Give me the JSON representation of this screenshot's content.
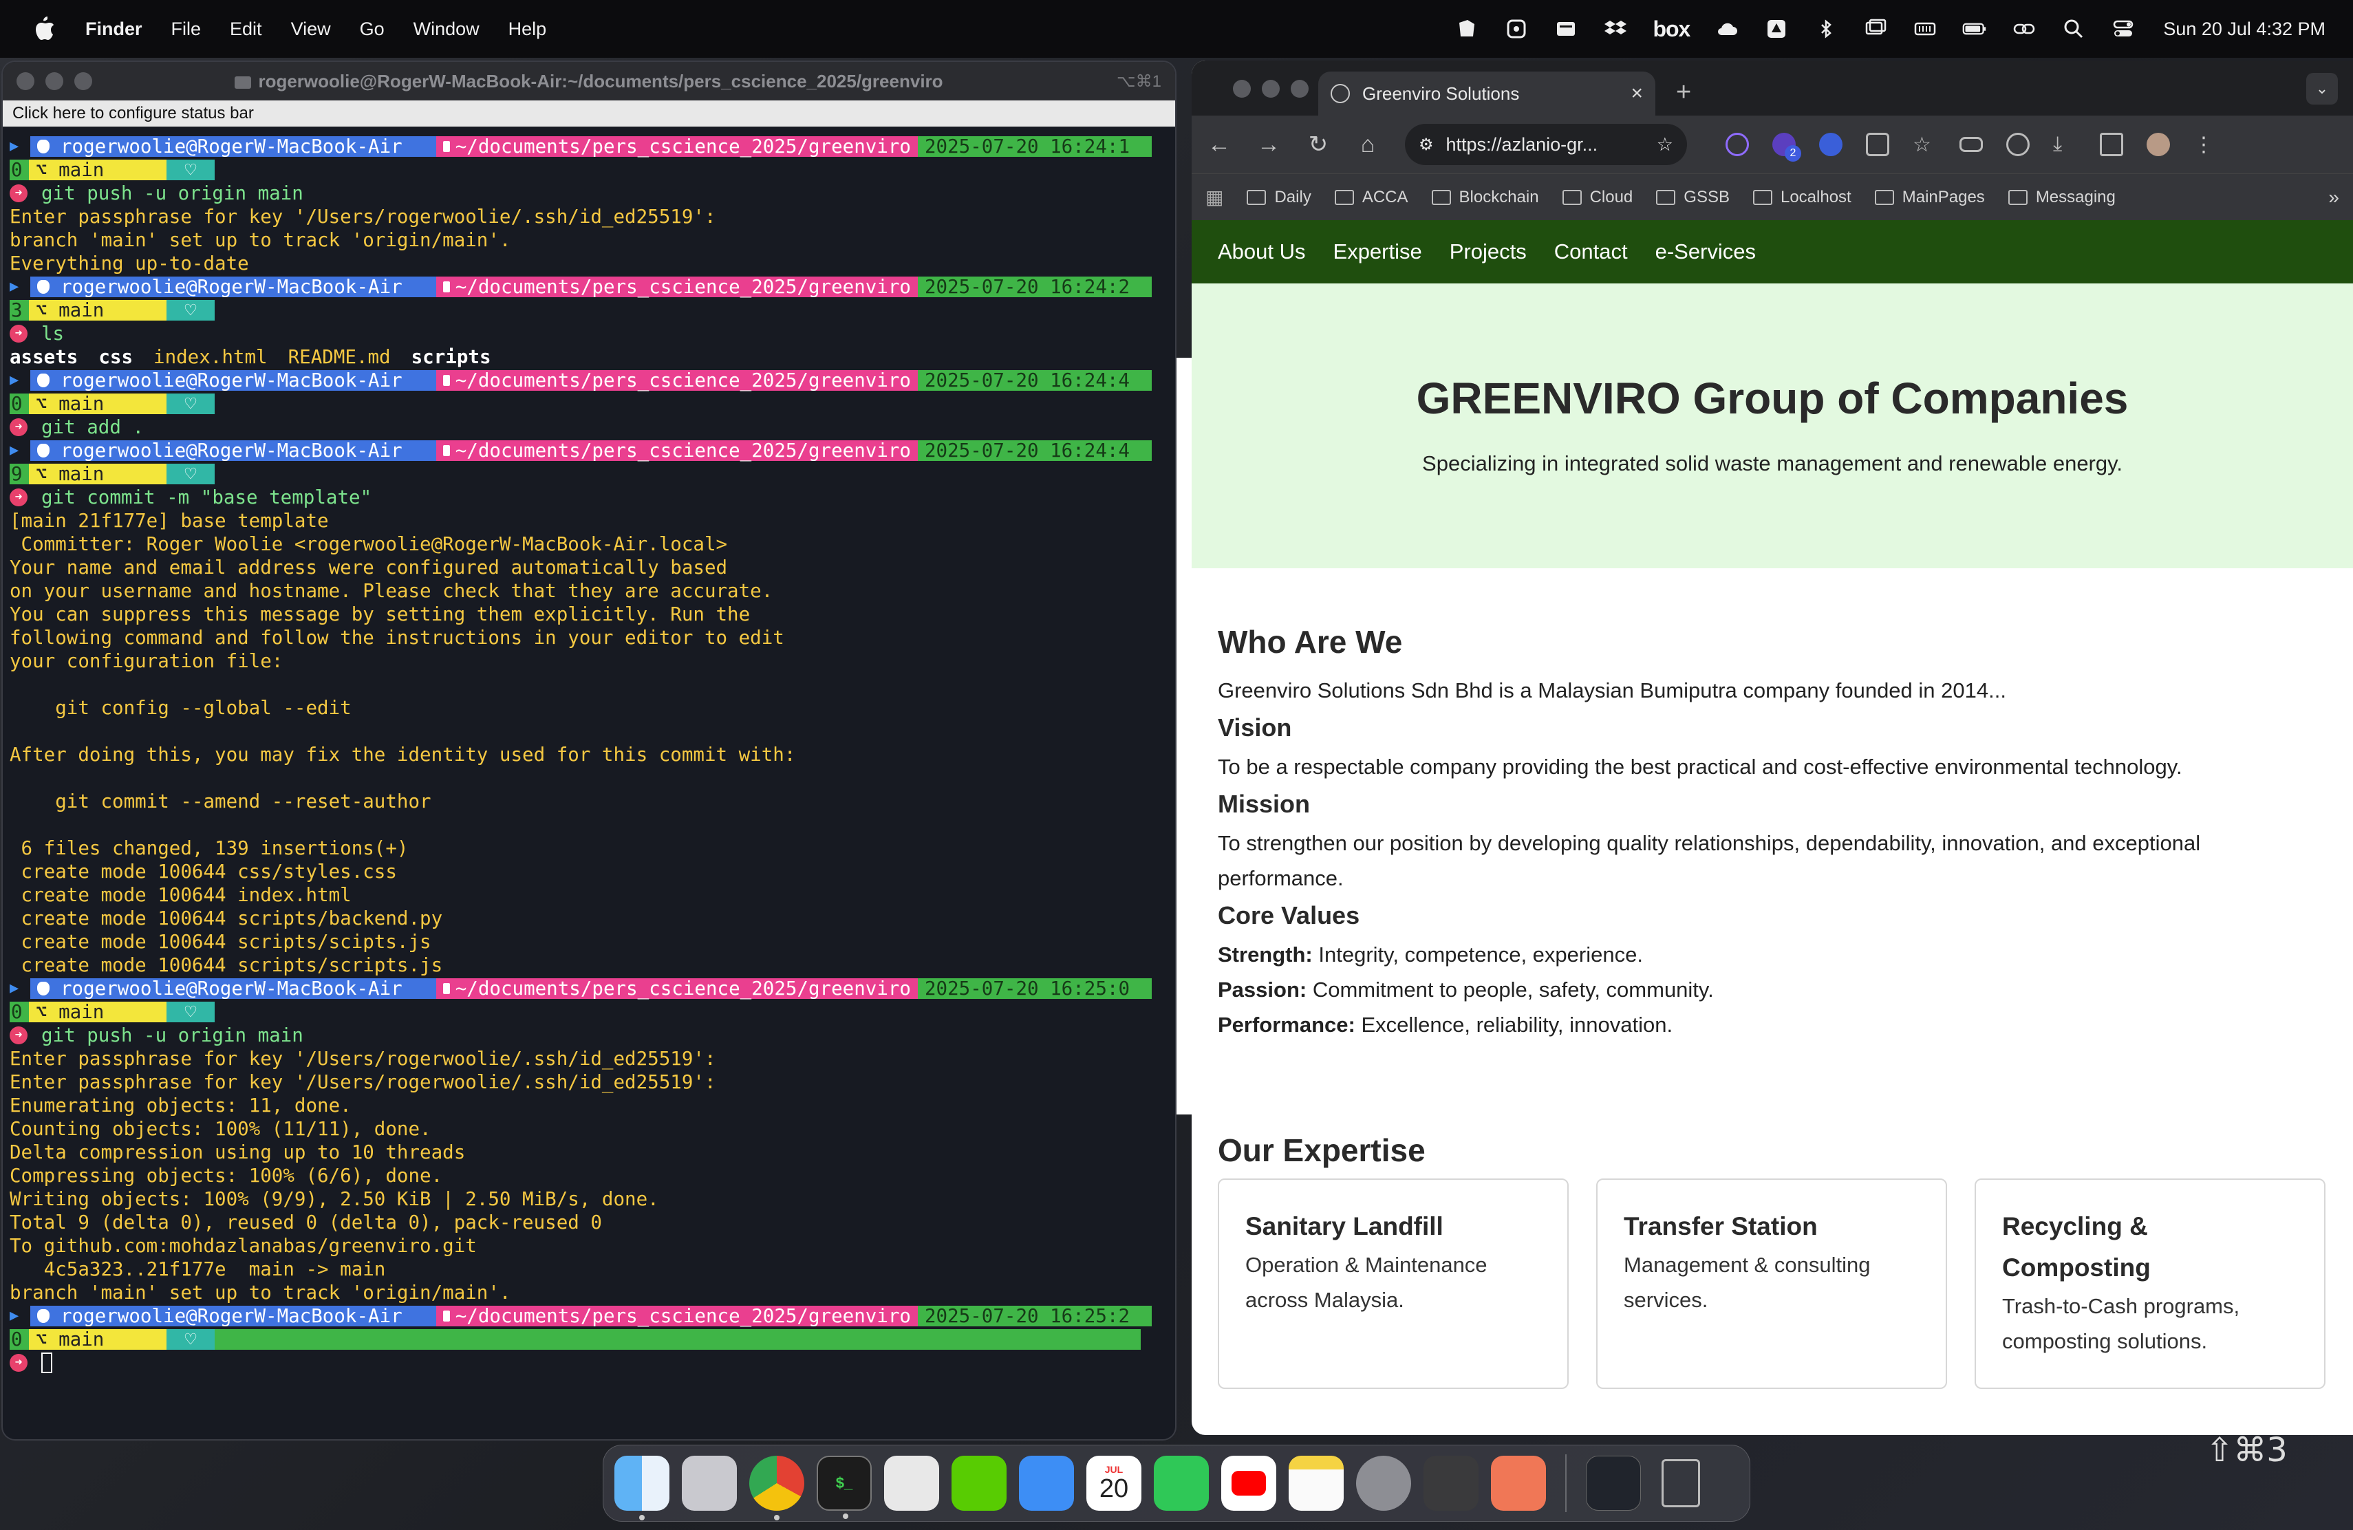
{
  "menubar": {
    "app": "Finder",
    "items": [
      "File",
      "Edit",
      "View",
      "Go",
      "Window",
      "Help"
    ],
    "box_label": "box",
    "clock": "Sun 20 Jul  4:32 PM"
  },
  "terminal": {
    "title": "rogerwoolie@RogerW-MacBook-Air:~/documents/pers_cscience_2025/greenviro",
    "shortcut": "⌥⌘1",
    "status_bar": "Click here to configure status bar",
    "prompt_user": "rogerwoolie@RogerW-MacBook-Air",
    "prompt_path": "~/documents/pers_cscience_2025/greenviro",
    "branch": "main",
    "blocks": [
      {
        "time": "2025-07-20 16:24:1",
        "exit": "0",
        "cmd": "git push -u origin main",
        "out": [
          "Enter passphrase for key '/Users/rogerwoolie/.ssh/id_ed25519':",
          "branch 'main' set up to track 'origin/main'.",
          "Everything up-to-date"
        ]
      },
      {
        "time": "2025-07-20 16:24:2",
        "exit": "3",
        "cmd": "ls",
        "out": []
      },
      {
        "time": "2025-07-20 16:24:4",
        "exit": "0",
        "cmd": "git add .",
        "out": []
      },
      {
        "time": "2025-07-20 16:24:4",
        "exit": "9",
        "cmd": "git commit -m \"base template\"",
        "out": [
          "[main 21f177e] base template",
          " Committer: Roger Woolie <rogerwoolie@RogerW-MacBook-Air.local>",
          "Your name and email address were configured automatically based",
          "on your username and hostname. Please check that they are accurate.",
          "You can suppress this message by setting them explicitly. Run the",
          "following command and follow the instructions in your editor to edit",
          "your configuration file:",
          "",
          "    git config --global --edit",
          "",
          "After doing this, you may fix the identity used for this commit with:",
          "",
          "    git commit --amend --reset-author",
          "",
          " 6 files changed, 139 insertions(+)",
          " create mode 100644 css/styles.css",
          " create mode 100644 index.html",
          " create mode 100644 scripts/backend.py",
          " create mode 100644 scripts/scipts.js",
          " create mode 100644 scripts/scripts.js"
        ]
      },
      {
        "time": "2025-07-20 16:25:0",
        "exit": "0",
        "cmd": "git push -u origin main",
        "out": [
          "Enter passphrase for key '/Users/rogerwoolie/.ssh/id_ed25519':",
          "Enter passphrase for key '/Users/rogerwoolie/.ssh/id_ed25519':",
          "Enumerating objects: 11, done.",
          "Counting objects: 100% (11/11), done.",
          "Delta compression using up to 10 threads",
          "Compressing objects: 100% (6/6), done.",
          "Writing objects: 100% (9/9), 2.50 KiB | 2.50 MiB/s, done.",
          "Total 9 (delta 0), reused 0 (delta 0), pack-reused 0",
          "To github.com:mohdazlanabas/greenviro.git",
          "   4c5a323..21f177e  main -> main",
          "branch 'main' set up to track 'origin/main'."
        ]
      },
      {
        "time": "2025-07-20 16:25:2",
        "exit": "0",
        "cmd": "",
        "out": []
      }
    ],
    "ls_items": [
      {
        "name": "assets",
        "kind": "dir"
      },
      {
        "name": "css",
        "kind": "dir"
      },
      {
        "name": "index.html",
        "kind": "file"
      },
      {
        "name": "README.md",
        "kind": "file"
      },
      {
        "name": "scripts",
        "kind": "dir"
      }
    ]
  },
  "browser": {
    "tab_title": "Greenviro Solutions",
    "url": "https://azlanio-gr...",
    "bookmarks": [
      "Daily",
      "ACCA",
      "Blockchain",
      "Cloud",
      "GSSB",
      "Localhost",
      "MainPages",
      "Messaging"
    ],
    "ext_badge": "2"
  },
  "site": {
    "nav": [
      "About Us",
      "Expertise",
      "Projects",
      "Contact",
      "e-Services"
    ],
    "hero_title": "GREENVIRO Group of Companies",
    "hero_subtitle": "Specializing in integrated solid waste management and renewable energy.",
    "who_title": "Who Are We",
    "who_text": "Greenviro Solutions Sdn Bhd is a Malaysian Bumiputra company founded in 2014...",
    "vision_title": "Vision",
    "vision_text": "To be a respectable company providing the best practical and cost-effective environmental technology.",
    "mission_title": "Mission",
    "mission_text": "To strengthen our position by developing quality relationships, dependability, innovation, and exceptional performance.",
    "values_title": "Core Values",
    "values": [
      {
        "label": "Strength:",
        "text": " Integrity, competence, experience."
      },
      {
        "label": "Passion:",
        "text": " Commitment to people, safety, community."
      },
      {
        "label": "Performance:",
        "text": " Excellence, reliability, innovation."
      }
    ],
    "expertise_title": "Our Expertise",
    "cards": [
      {
        "title": "Sanitary Landfill",
        "text": "Operation & Maintenance across Malaysia."
      },
      {
        "title": "Transfer Station",
        "text": "Management & consulting services."
      },
      {
        "title": "Recycling & Composting",
        "text": "Trash-to-Cash programs, composting solutions."
      }
    ]
  },
  "dock": {
    "calendar_month": "JUL",
    "calendar_day": "20"
  },
  "ghost_shortcut": "⇧⌘3"
}
